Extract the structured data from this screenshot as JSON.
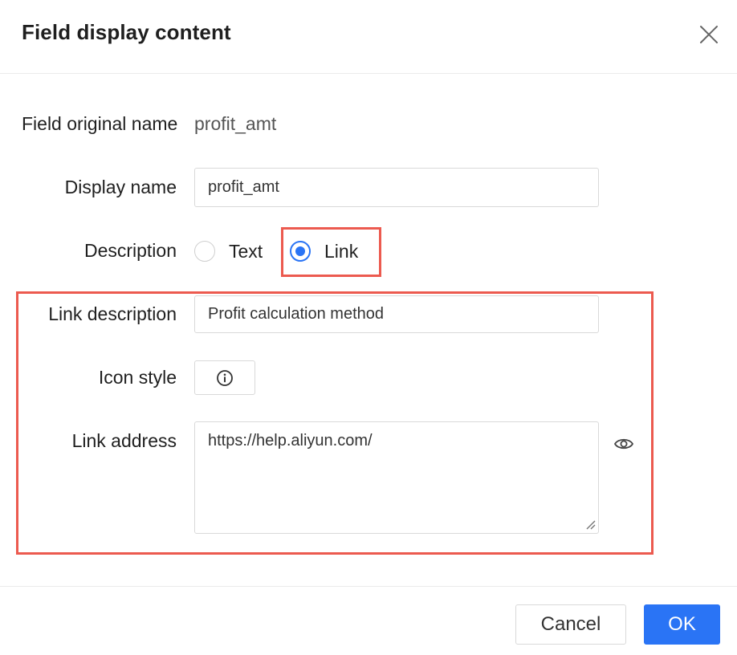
{
  "dialog": {
    "title": "Field display content",
    "close_icon": "close-icon"
  },
  "form": {
    "original_name": {
      "label": "Field original name",
      "value": "profit_amt"
    },
    "display_name": {
      "label": "Display name",
      "value": "profit_amt"
    },
    "description": {
      "label": "Description",
      "options": [
        {
          "label": "Text",
          "checked": false
        },
        {
          "label": "Link",
          "checked": true
        }
      ]
    },
    "link_description": {
      "label": "Link description",
      "value": "Profit calculation method"
    },
    "icon_style": {
      "label": "Icon style",
      "icon": "info-icon"
    },
    "link_address": {
      "label": "Link address",
      "value": "https://help.aliyun.com/",
      "preview_icon": "eye-icon"
    }
  },
  "footer": {
    "cancel_label": "Cancel",
    "ok_label": "OK"
  },
  "colors": {
    "accent": "#2a74f5",
    "highlight": "#ec5a4f"
  }
}
